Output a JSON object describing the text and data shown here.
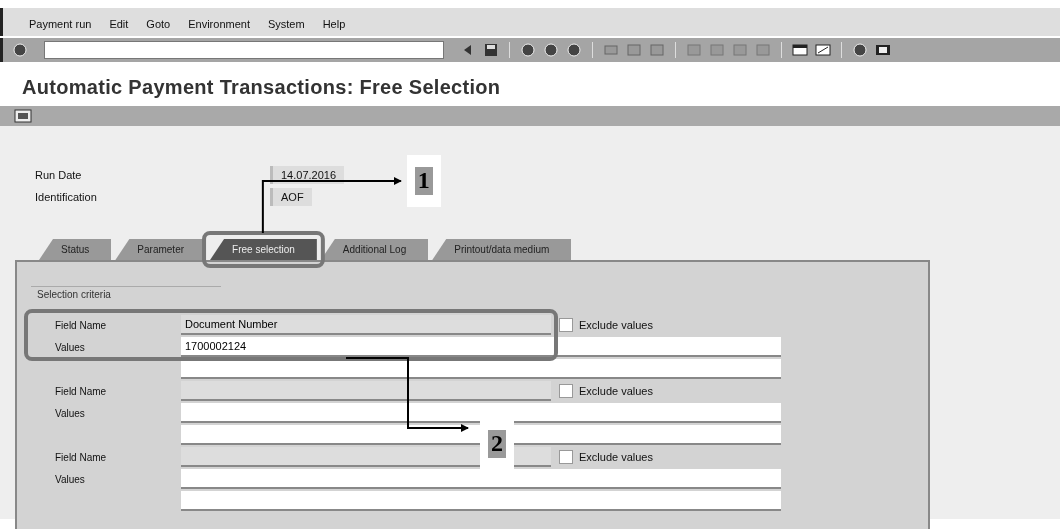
{
  "menu": [
    "Payment run",
    "Edit",
    "Goto",
    "Environment",
    "System",
    "Help"
  ],
  "screen_title": "Automatic Payment Transactions: Free Selection",
  "header_fields": [
    {
      "label": "Run Date",
      "value": "14.07.2016"
    },
    {
      "label": "Identification",
      "value": "AOF"
    }
  ],
  "tabs": [
    {
      "label": "Status",
      "selected": false
    },
    {
      "label": "Parameter",
      "selected": false
    },
    {
      "label": "Free selection",
      "selected": true
    },
    {
      "label": "Additional Log",
      "selected": false
    },
    {
      "label": "Printout/data medium",
      "selected": false
    }
  ],
  "group_title": "Selection criteria",
  "selections": [
    {
      "field_label": "Field Name",
      "field_value": "Document Number",
      "values_label": "Values",
      "values_value": "1700002124",
      "exclude_label": "Exclude values",
      "exclude": false
    },
    {
      "field_label": "Field Name",
      "values_label": "Values",
      "exclude_label": "Exclude values",
      "exclude": false
    },
    {
      "field_label": "Field Name",
      "values_label": "Values",
      "exclude_label": "Exclude values",
      "exclude": false
    }
  ],
  "annotations": [
    {
      "label": "1"
    },
    {
      "label": "2"
    }
  ]
}
